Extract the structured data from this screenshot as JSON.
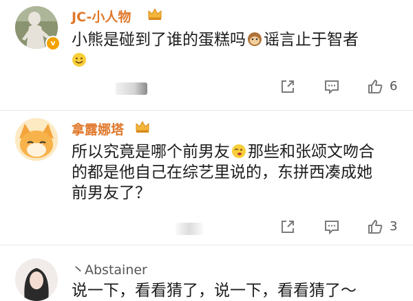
{
  "comments": [
    {
      "username": "JC-小人物",
      "text_line1": "小熊是碰到了谁的蛋糕吗",
      "text_line1_tail": "谣言止于智者",
      "like_count": "6"
    },
    {
      "username": "拿露娜塔",
      "text_line1_a": "所以究竟是哪个前男友",
      "text_line1_b": "那些和张颂文吻合",
      "text_line2": "的都是他自己在综艺里说的，东拼西凑成她",
      "text_line3": "前男友了？",
      "like_count": "3"
    },
    {
      "username": "丶Abstainer",
      "text_partial": "说一下，看看猜了，说一下，看看猜了～"
    }
  ],
  "colors": {
    "username": "#e0782b",
    "icon": "#7a7a7a",
    "separator": "#e8e8e8"
  },
  "icons": [
    "verified-badge-icon",
    "crown-icon",
    "share-icon",
    "comment-icon",
    "like-icon",
    "monkey-emoji-icon",
    "smile-emoji-icon",
    "wink-emoji-icon"
  ]
}
